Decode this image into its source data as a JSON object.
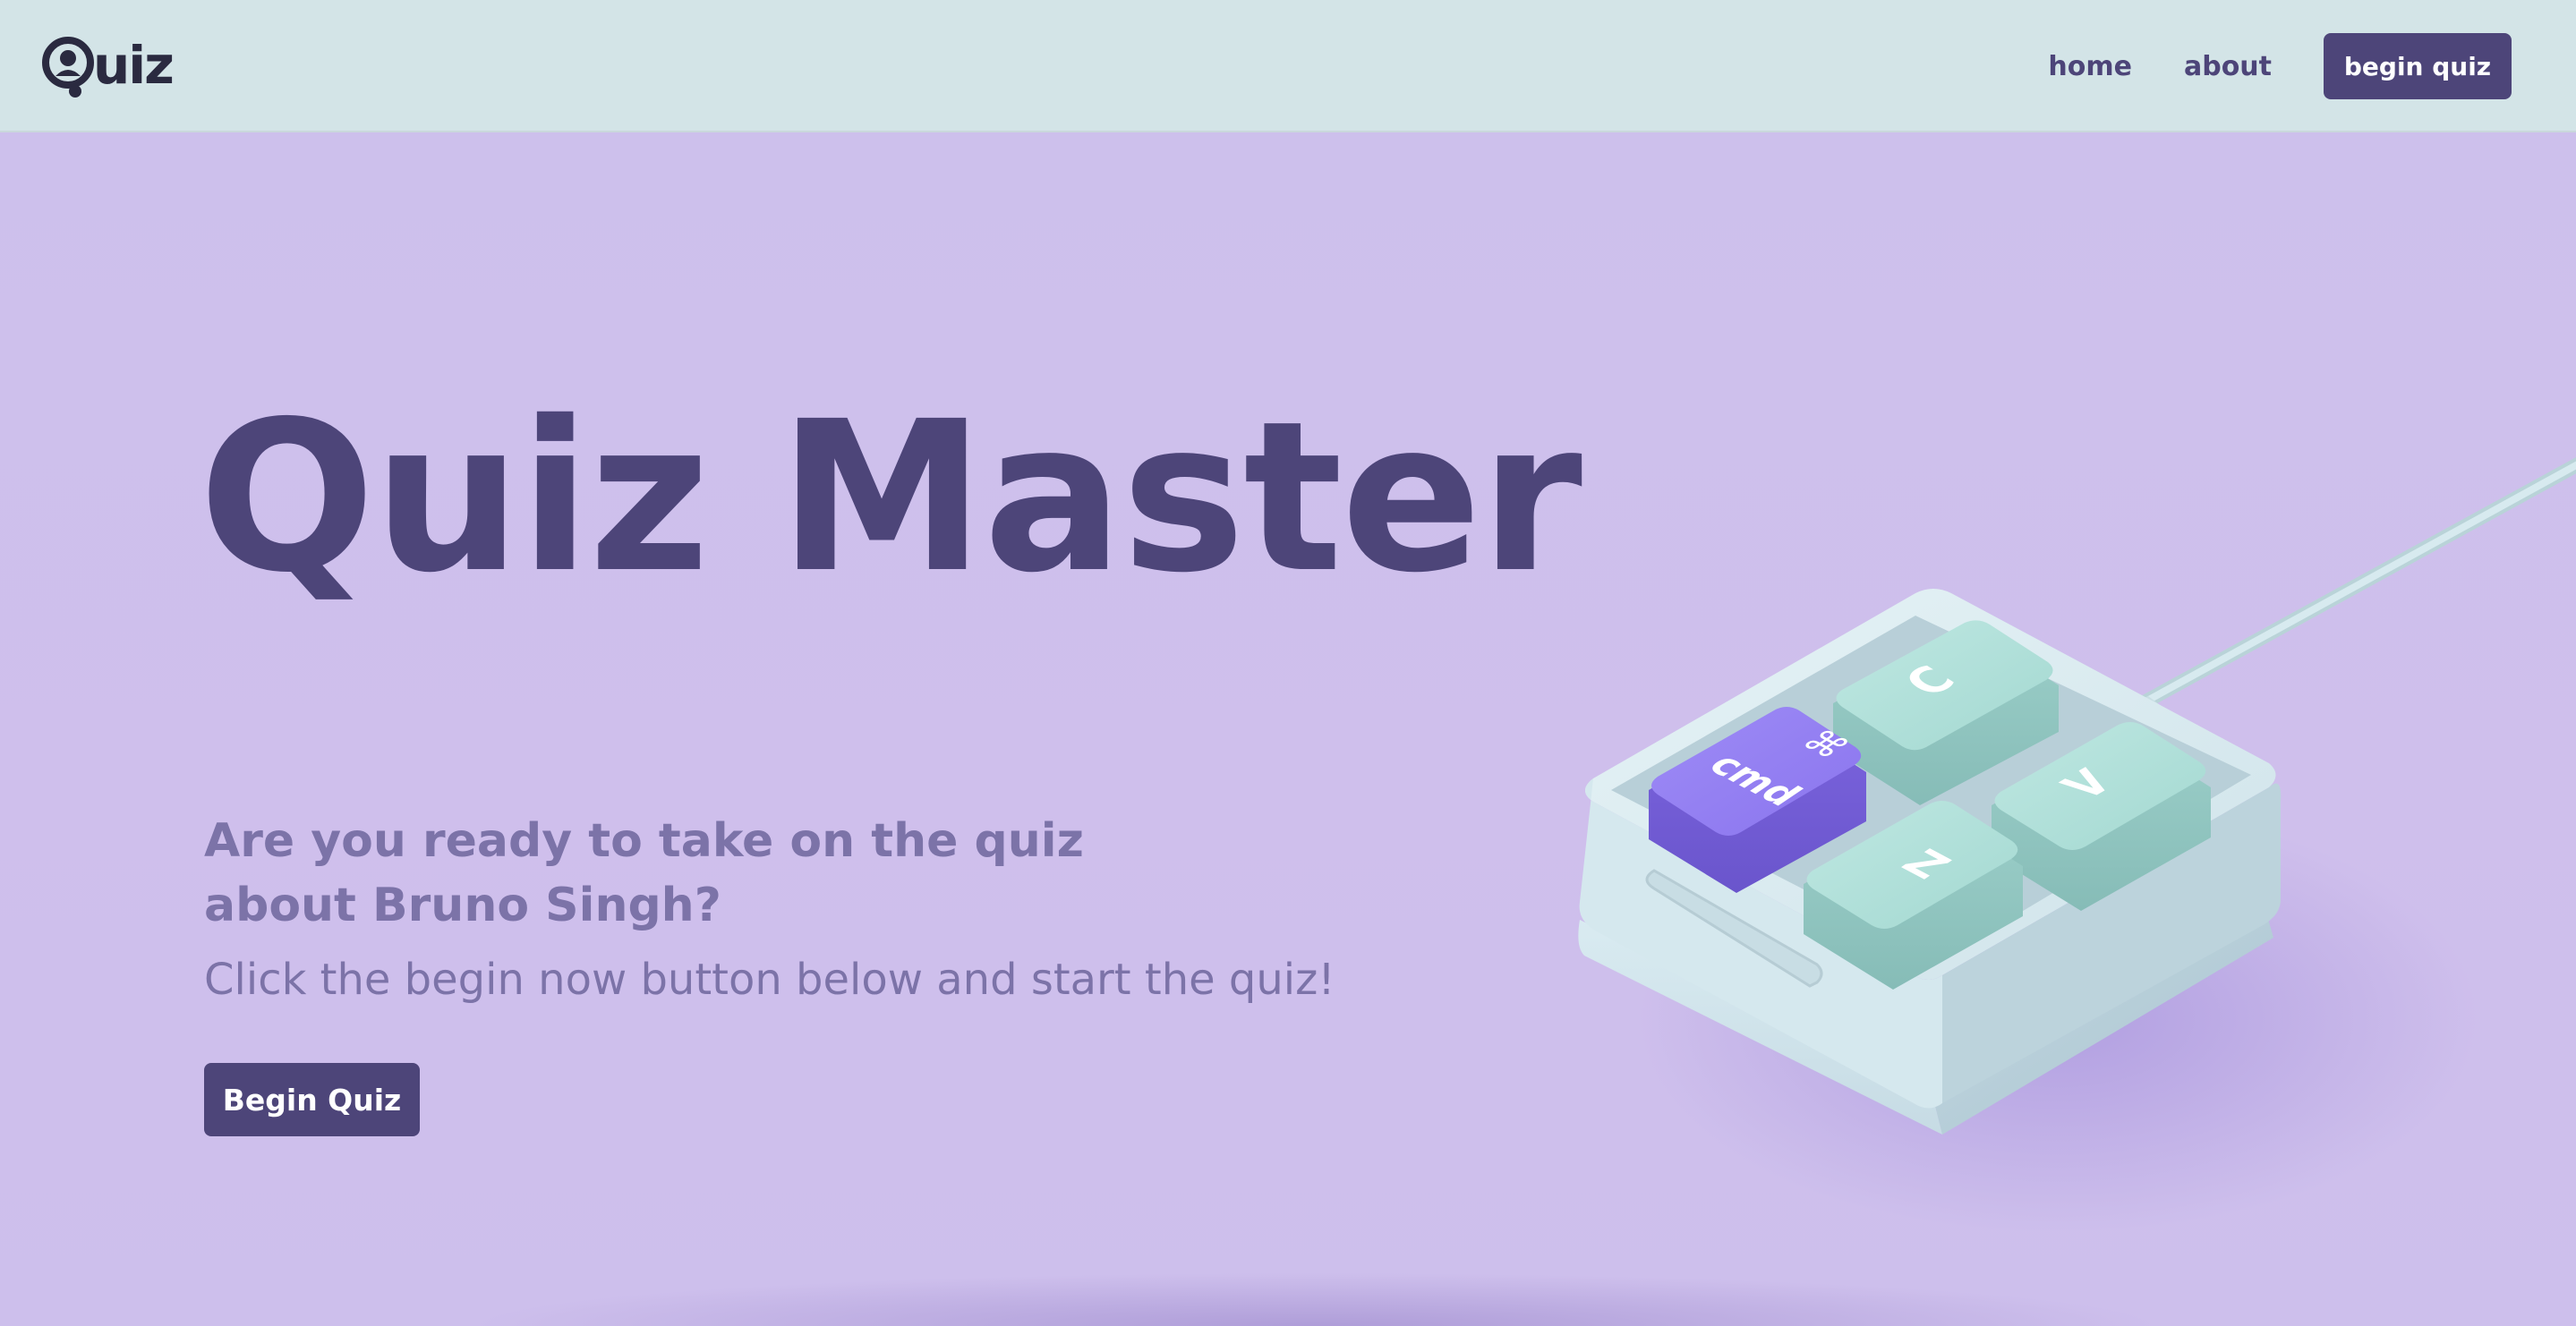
{
  "header": {
    "logo_text": "uiz",
    "logo_letter": "Q",
    "nav": {
      "home_label": "home",
      "about_label": "about",
      "begin_label": "begin quiz"
    }
  },
  "hero": {
    "title": "Quiz Master",
    "subtitle_line1": "Are you ready to take on the quiz",
    "subtitle_line2": "about Bruno Singh?",
    "text": "Click the begin now button below and start the quiz!",
    "button_label": "Begin Quiz"
  },
  "keypad": {
    "keys": {
      "cmd": "cmd",
      "cmd_symbol": "⌘",
      "c": "C",
      "v": "V",
      "z": "Z"
    }
  },
  "colors": {
    "header_bg": "#d3e4e7",
    "hero_bg": "#cdc0ec",
    "primary": "#4d4579",
    "secondary_text": "#7c73a8",
    "key_mint": "#a9dcd6",
    "key_purple": "#8e76f0",
    "keypad_base": "#d7eaf0"
  }
}
